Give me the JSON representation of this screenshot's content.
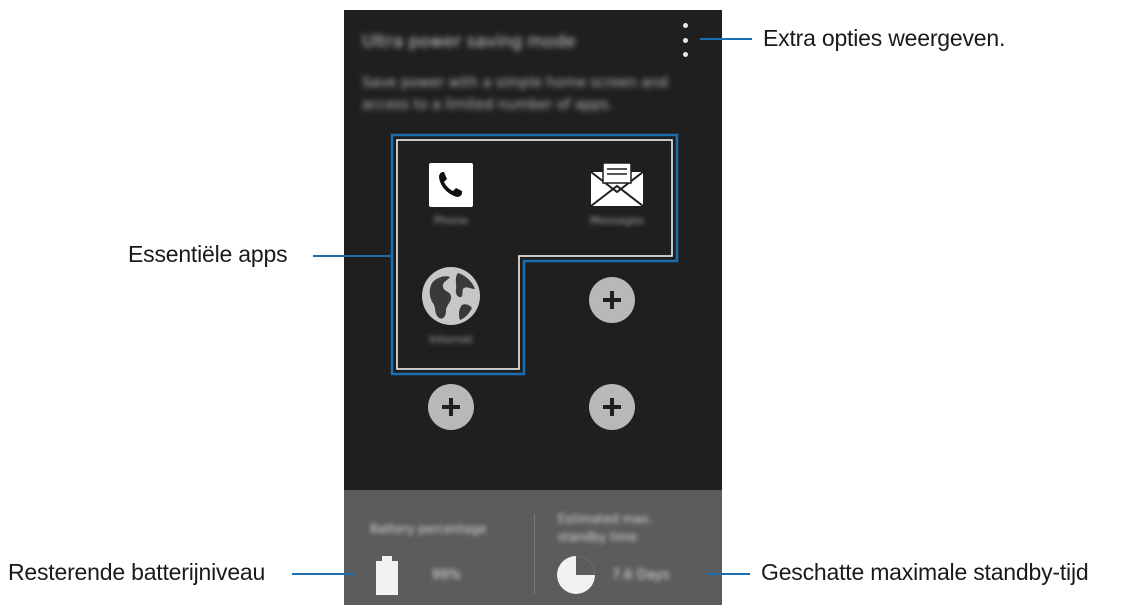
{
  "phone": {
    "title": "Ultra power saving mode",
    "description": "Save power with a simple home screen and access to a limited number of apps.",
    "apps": [
      {
        "label": "Phone",
        "icon": "phone-icon"
      },
      {
        "label": "Messages",
        "icon": "envelope-icon"
      },
      {
        "label": "Internet",
        "icon": "globe-icon"
      }
    ],
    "add_slots": 3,
    "battery_caption": "Battery percentage",
    "battery_value": "99%",
    "standby_caption": "Estimated max. standby time",
    "standby_value": "7.6 Days"
  },
  "callouts": {
    "more_options": "Extra opties weergeven.",
    "essential_apps": "Essentiële apps",
    "battery_level": "Resterende batterijniveau",
    "standby_time": "Geschatte maximale standby-tijd"
  },
  "colors": {
    "callout_line": "#1a6fb2",
    "highlight_border": "#1a6fb2",
    "screen_bg": "#1f1f1f",
    "bottom_bar_bg": "#5c5c5c"
  }
}
